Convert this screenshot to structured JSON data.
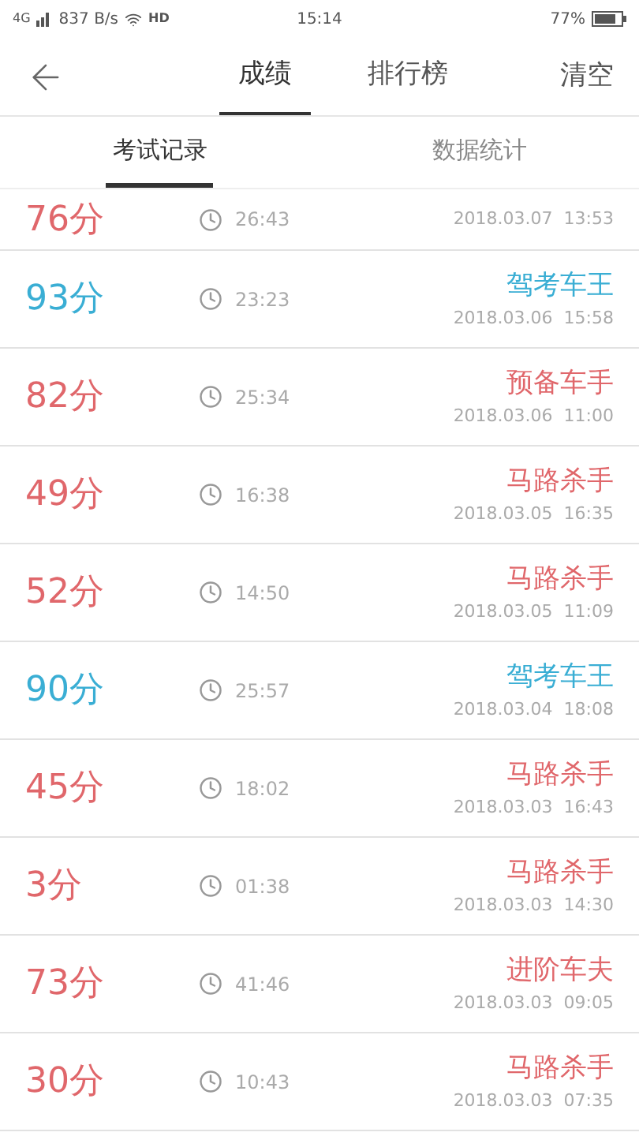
{
  "status_bar": {
    "network": "4G",
    "speed": "837 B/s",
    "hd": "HD",
    "time": "15:14",
    "battery": "77%"
  },
  "header": {
    "tabs": [
      {
        "label": "成绩",
        "selected": true
      },
      {
        "label": "排行榜",
        "selected": false
      }
    ],
    "action": "清空"
  },
  "subtabs": [
    {
      "label": "考试记录",
      "selected": true
    },
    {
      "label": "数据统计",
      "selected": false
    }
  ],
  "records": [
    {
      "score": "76分",
      "duration": "26:43",
      "date": "2018.03.07",
      "clock": "13:53",
      "color": "#e0676b"
    },
    {
      "score": "93分",
      "duration": "23:23",
      "title": "驾考车王",
      "date": "2018.03.06",
      "clock": "15:58",
      "color": "#3aaed4"
    },
    {
      "score": "82分",
      "duration": "25:34",
      "title": "预备车手",
      "date": "2018.03.06",
      "clock": "11:00",
      "color": "#e0676b"
    },
    {
      "score": "49分",
      "duration": "16:38",
      "title": "马路杀手",
      "date": "2018.03.05",
      "clock": "16:35",
      "color": "#e0676b"
    },
    {
      "score": "52分",
      "duration": "14:50",
      "title": "马路杀手",
      "date": "2018.03.05",
      "clock": "11:09",
      "color": "#e0676b"
    },
    {
      "score": "90分",
      "duration": "25:57",
      "title": "驾考车王",
      "date": "2018.03.04",
      "clock": "18:08",
      "color": "#3aaed4"
    },
    {
      "score": "45分",
      "duration": "18:02",
      "title": "马路杀手",
      "date": "2018.03.03",
      "clock": "16:43",
      "color": "#e0676b"
    },
    {
      "score": "3分",
      "duration": "01:38",
      "title": "马路杀手",
      "date": "2018.03.03",
      "clock": "14:30",
      "color": "#e0676b"
    },
    {
      "score": "73分",
      "duration": "41:46",
      "title": "进阶车夫",
      "date": "2018.03.03",
      "clock": "09:05",
      "color": "#e0676b"
    },
    {
      "score": "30分",
      "duration": "10:43",
      "title": "马路杀手",
      "date": "2018.03.03",
      "clock": "07:35",
      "color": "#e0676b"
    }
  ]
}
